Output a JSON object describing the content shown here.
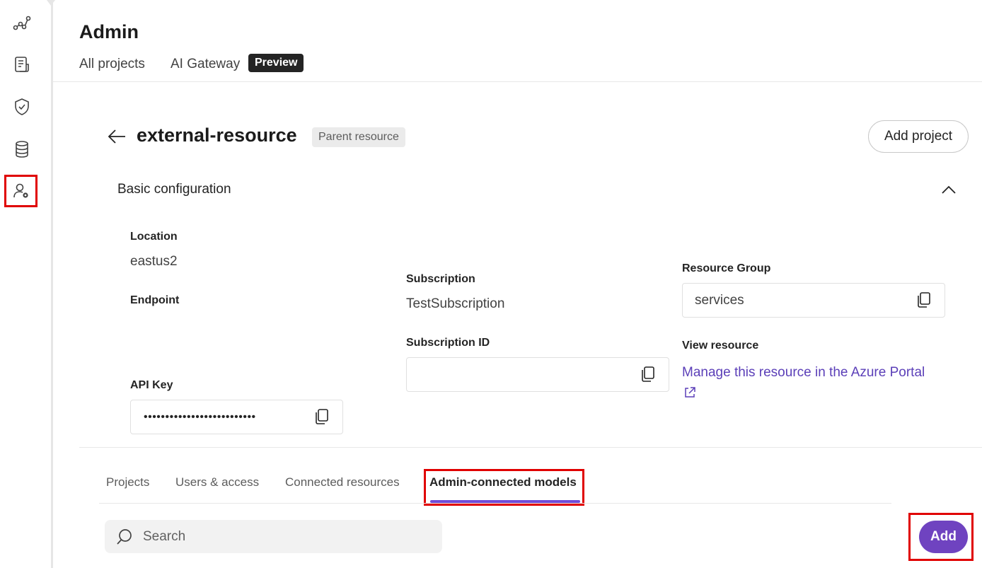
{
  "sidebar": {
    "icons": [
      "graph-icon",
      "notes-icon",
      "shield-check-icon",
      "database-icon",
      "user-settings-icon"
    ]
  },
  "header": {
    "title": "Admin",
    "tabs": [
      {
        "label": "All projects"
      },
      {
        "label": "AI Gateway"
      }
    ],
    "preview_badge": "Preview"
  },
  "resource": {
    "name": "external-resource",
    "badge": "Parent resource",
    "add_project_label": "Add project"
  },
  "basic_config": {
    "title": "Basic configuration",
    "location_label": "Location",
    "location_value": "eastus2",
    "endpoint_label": "Endpoint",
    "api_key_label": "API Key",
    "api_key_value": "••••••••••••••••••••••••••",
    "subscription_label": "Subscription",
    "subscription_value": "TestSubscription",
    "subscription_id_label": "Subscription ID",
    "resource_group_label": "Resource Group",
    "resource_group_value": "services",
    "view_resource_label": "View resource",
    "view_resource_link": "Manage this resource in the Azure Portal"
  },
  "tabs": [
    {
      "label": "Projects"
    },
    {
      "label": "Users & access"
    },
    {
      "label": "Connected resources"
    },
    {
      "label": "Admin-connected models"
    }
  ],
  "search": {
    "placeholder": "Search"
  },
  "add_label": "Add"
}
